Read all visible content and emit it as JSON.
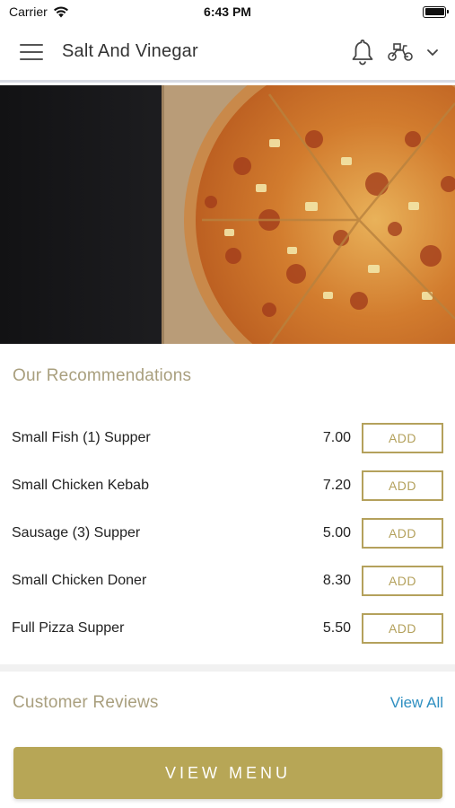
{
  "status_bar": {
    "carrier": "Carrier",
    "time": "6:43 PM"
  },
  "header": {
    "title": "Salt And Vinegar",
    "icons": [
      "menu-icon",
      "bell-icon",
      "delivery-scooter-icon",
      "chevron-down-icon"
    ]
  },
  "recommendations": {
    "title": "Our Recommendations",
    "items": [
      {
        "name": "Small Fish (1) Supper",
        "price": "7.00",
        "button": "ADD"
      },
      {
        "name": "Small Chicken Kebab",
        "price": "7.20",
        "button": "ADD"
      },
      {
        "name": "Sausage (3) Supper",
        "price": "5.00",
        "button": "ADD"
      },
      {
        "name": "Small Chicken Doner",
        "price": "8.30",
        "button": "ADD"
      },
      {
        "name": "Full Pizza Supper",
        "price": "5.50",
        "button": "ADD"
      }
    ]
  },
  "reviews": {
    "title": "Customer Reviews",
    "view_all": "View All"
  },
  "footer": {
    "view_menu": "VIEW MENU"
  },
  "colors": {
    "accent": "#b7a656",
    "section_title": "#a99f7e",
    "link": "#2e8fc1"
  }
}
